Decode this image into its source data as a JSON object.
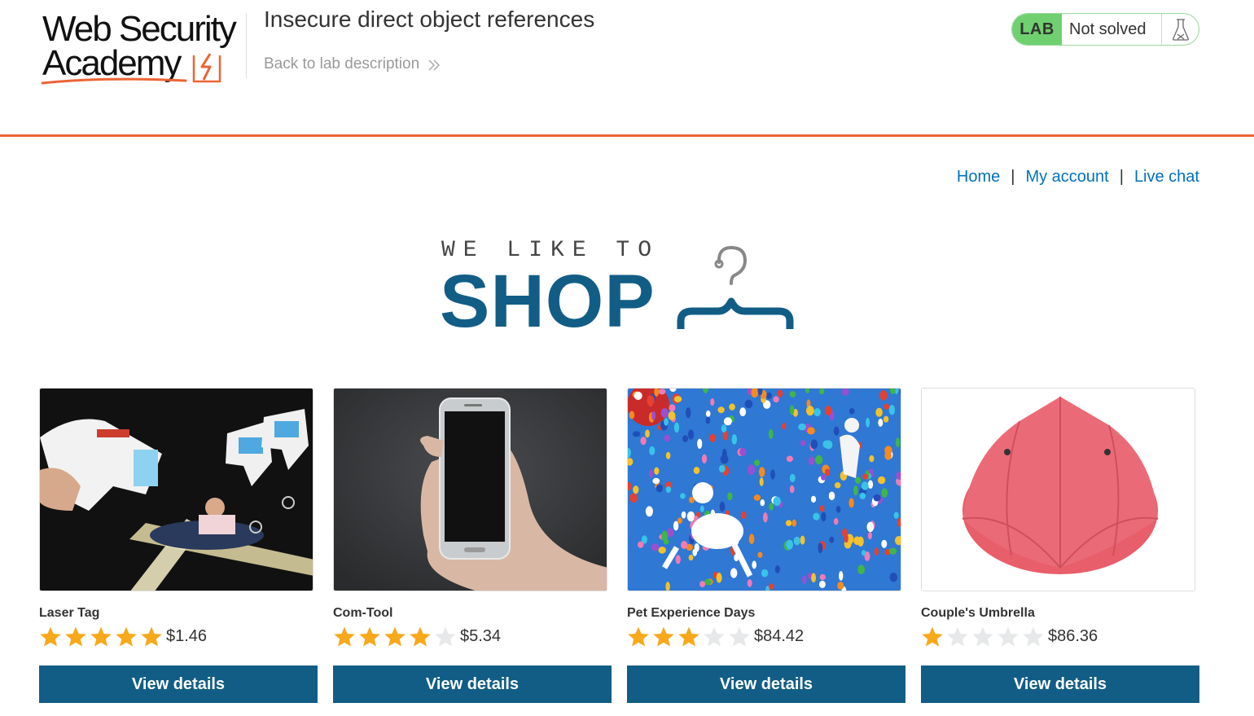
{
  "academy": {
    "logo_line1": "Web Security",
    "logo_line2": "Academy",
    "lab_title": "Insecure direct object references",
    "back_link": "Back to lab description",
    "lab_badge": "LAB",
    "lab_status": "Not solved",
    "accent_color": "#ec6435"
  },
  "nav": {
    "home": "Home",
    "separator": "|",
    "my_account": "My account",
    "live_chat": "Live chat",
    "link_color": "#0071bc"
  },
  "banner": {
    "tagline": "WE LIKE TO",
    "word": "SHOP",
    "brand_color": "#125d86"
  },
  "products": [
    {
      "name": "Laser Tag",
      "rating": 5,
      "price": "$1.46",
      "button": "View details",
      "image": "laser-tag-image"
    },
    {
      "name": "Com-Tool",
      "rating": 4,
      "price": "$5.34",
      "button": "View details",
      "image": "smartphone-in-hand-image"
    },
    {
      "name": "Pet Experience Days",
      "rating": 3,
      "price": "$84.42",
      "button": "View details",
      "image": "dogs-with-balloons-image"
    },
    {
      "name": "Couple's Umbrella",
      "rating": 1,
      "price": "$86.36",
      "button": "View details",
      "image": "red-double-umbrella-image"
    }
  ]
}
